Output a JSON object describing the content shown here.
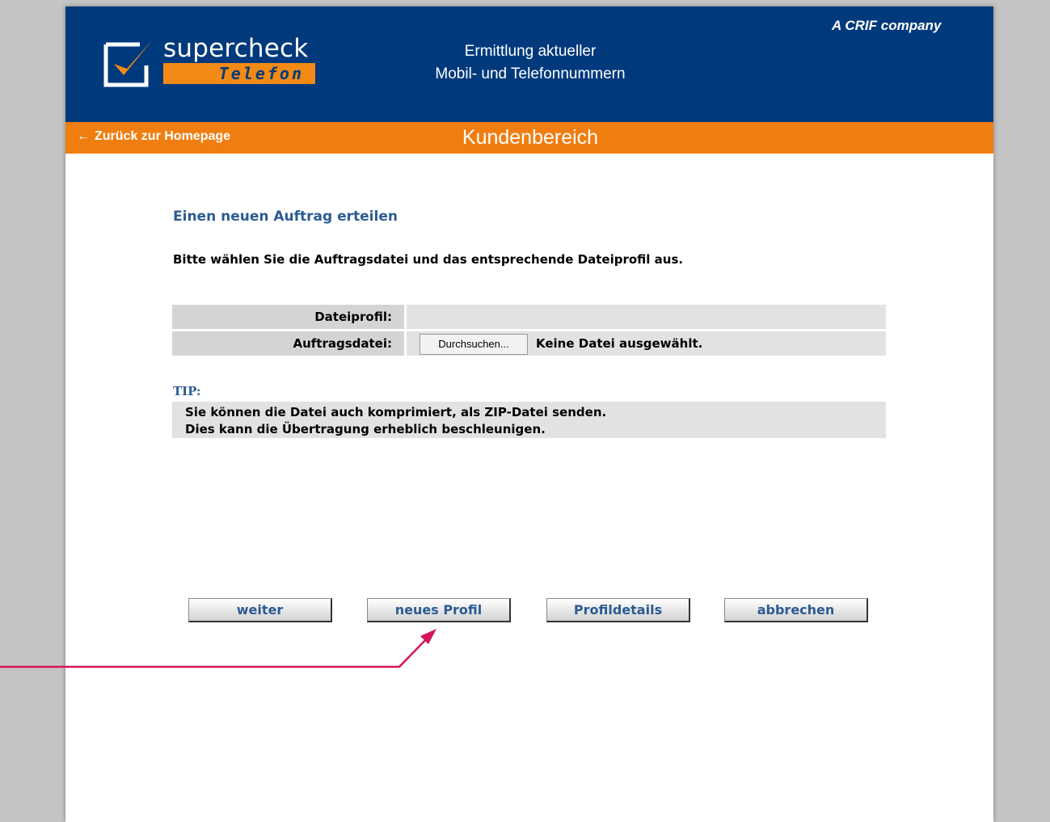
{
  "header": {
    "logo": {
      "word": "supercheck",
      "sub": "Telefon"
    },
    "tagline_line1": "Ermittlung aktueller",
    "tagline_line2": "Mobil- und Telefonnummern",
    "crif": "A CRIF company"
  },
  "nav": {
    "back_label": "Zurück zur Homepage",
    "section_title": "Kundenbereich"
  },
  "main": {
    "heading": "Einen neuen Auftrag erteilen",
    "instruction": "Bitte wählen Sie die Auftragsdatei und das entsprechende Dateiprofil aus.",
    "form": {
      "profile_label": "Dateiprofil:",
      "profile_value": "",
      "file_label": "Auftragsdatei:",
      "browse_label": "Durchsuchen...",
      "file_status": "Keine Datei ausgewählt."
    },
    "tip": {
      "label": "TIP:",
      "line1": "Sie können die Datei auch komprimiert, als ZIP-Datei senden.",
      "line2": "Dies kann die Übertragung erheblich beschleunigen."
    }
  },
  "actions": {
    "next": "weiter",
    "new_profile": "neues Profil",
    "details": "Profildetails",
    "cancel": "abbrechen"
  },
  "colors": {
    "header_blue": "#003a7c",
    "orange": "#f07d10",
    "link_blue": "#2c5b94",
    "annotation": "#d4145a"
  },
  "icons": {
    "back": "arrow-left-icon",
    "logo": "checkmark-icon",
    "annotation": "arrow-annotation"
  }
}
